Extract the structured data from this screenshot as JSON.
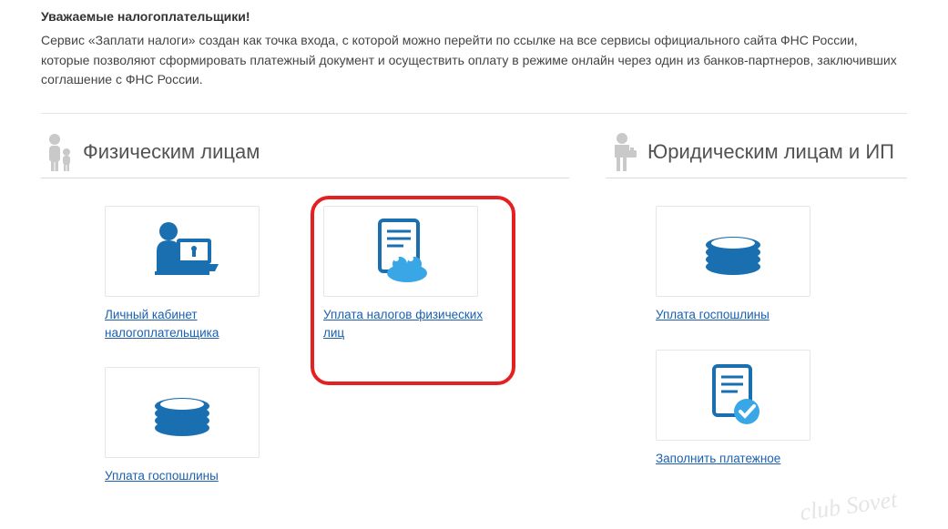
{
  "heading": "Уважаемые налогоплательщики!",
  "intro": "Сервис «Заплати налоги» создан как точка входа, с которой можно перейти по ссылке на все сервисы официального сайта ФНС России, которые позволяют сформировать платежный документ и осуществить оплату в режиме онлайн через один из банков-партнеров, заключивших соглашение с ФНС России.",
  "sections": {
    "individuals": {
      "title": "Физическим лицам"
    },
    "legal": {
      "title": "Юридическим лицам и ИП"
    }
  },
  "cards": {
    "cabinet": {
      "label": "Личный кабинет налогоплательщика"
    },
    "pay_ind": {
      "label": "Уплата налогов физических лиц"
    },
    "duty1": {
      "label": "Уплата госпошлины"
    },
    "duty2": {
      "label": "Уплата госпошлины"
    },
    "fill": {
      "label": "Заполнить платежное"
    }
  },
  "watermark": "club Sovet"
}
